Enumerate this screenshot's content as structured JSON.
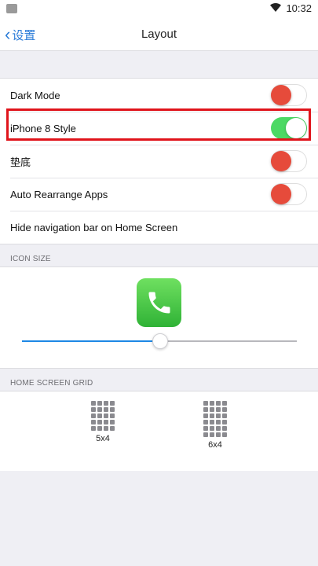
{
  "status_bar": {
    "time": "10:32"
  },
  "nav": {
    "back_label": "设置",
    "title": "Layout"
  },
  "settings": [
    {
      "label": "Dark Mode",
      "toggle": "off"
    },
    {
      "label": "iPhone 8 Style",
      "toggle": "on"
    },
    {
      "label": "垫底",
      "toggle": "off"
    },
    {
      "label": "Auto Rearrange Apps",
      "toggle": "off"
    },
    {
      "label": "Hide navigation bar on Home Screen"
    }
  ],
  "icon_size": {
    "header": "ICON SIZE",
    "slider_value_fraction": 0.5
  },
  "home_grid": {
    "header": "HOME SCREEN GRID",
    "options": [
      {
        "label": "5x4"
      },
      {
        "label": "6x4"
      }
    ]
  },
  "colors": {
    "toggle_on": "#4cd964",
    "toggle_off_knob": "#e64b3b",
    "accent": "#2a7bd8",
    "highlight_border": "#e0141b"
  }
}
